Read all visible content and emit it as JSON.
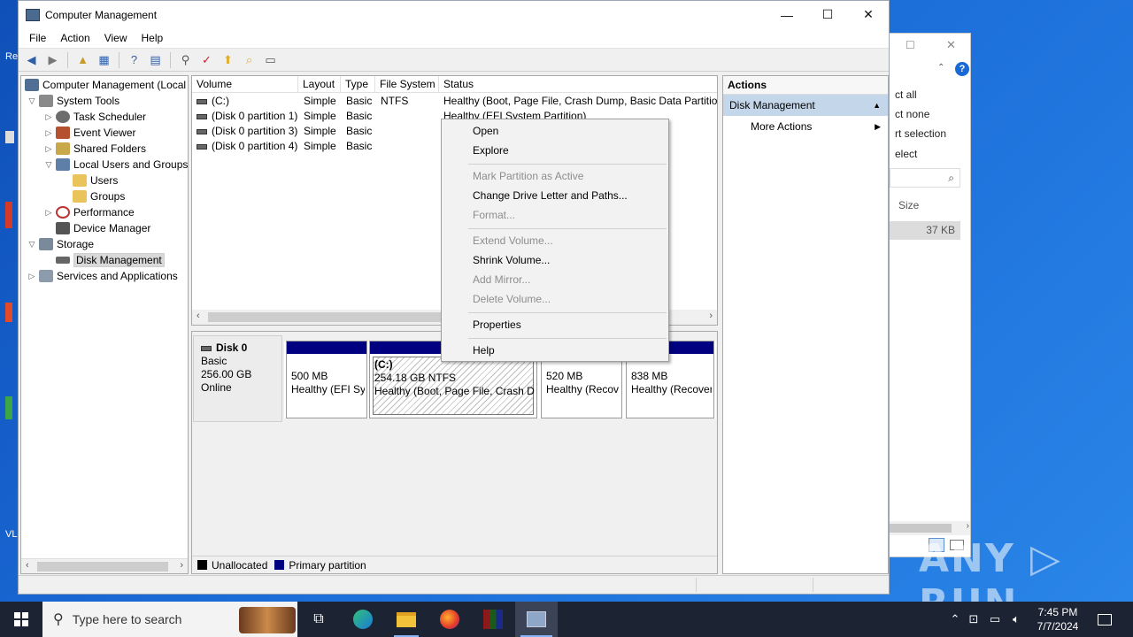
{
  "window": {
    "title": "Computer Management",
    "minimize": "—",
    "maximize": "☐",
    "close": "✕"
  },
  "menu": [
    "File",
    "Action",
    "View",
    "Help"
  ],
  "tree": {
    "root": "Computer Management (Local",
    "system_tools": "System Tools",
    "task_scheduler": "Task Scheduler",
    "event_viewer": "Event Viewer",
    "shared_folders": "Shared Folders",
    "local_users": "Local Users and Groups",
    "users": "Users",
    "groups": "Groups",
    "performance": "Performance",
    "device_manager": "Device Manager",
    "storage": "Storage",
    "disk_management": "Disk Management",
    "services": "Services and Applications"
  },
  "list": {
    "headers": [
      "Volume",
      "Layout",
      "Type",
      "File System",
      "Status"
    ],
    "rows": [
      [
        "(C:)",
        "Simple",
        "Basic",
        "NTFS",
        "Healthy (Boot, Page File, Crash Dump, Basic Data Partition)"
      ],
      [
        "(Disk 0 partition 1)",
        "Simple",
        "Basic",
        "",
        "Healthy (EFI System Partition)"
      ],
      [
        "(Disk 0 partition 3)",
        "Simple",
        "Basic",
        "",
        ""
      ],
      [
        "(Disk 0 partition 4)",
        "Simple",
        "Basic",
        "",
        ""
      ]
    ]
  },
  "disk": {
    "name": "Disk 0",
    "type": "Basic",
    "size": "256.00 GB",
    "status": "Online",
    "partitions": [
      {
        "size": "500 MB",
        "status": "Healthy (EFI Sy"
      },
      {
        "label": "(C:)",
        "size": "254.18 GB NTFS",
        "status": "Healthy (Boot, Page File, Crash Du"
      },
      {
        "size": "520 MB",
        "status": "Healthy (Recov"
      },
      {
        "size": "838 MB",
        "status": "Healthy (Recover"
      }
    ]
  },
  "legend": {
    "unallocated": "Unallocated",
    "primary": "Primary partition",
    "unallocated_color": "#000000",
    "primary_color": "#000080"
  },
  "actions": {
    "header": "Actions",
    "section": "Disk Management",
    "more": "More Actions"
  },
  "context_menu": {
    "open": "Open",
    "explore": "Explore",
    "mark_active": "Mark Partition as Active",
    "change_letter": "Change Drive Letter and Paths...",
    "format": "Format...",
    "extend": "Extend Volume...",
    "shrink": "Shrink Volume...",
    "add_mirror": "Add Mirror...",
    "delete": "Delete Volume...",
    "properties": "Properties",
    "help": "Help"
  },
  "bg_window": {
    "select_all": "ct all",
    "select_none": "ct none",
    "invert": "rt selection",
    "select": "elect",
    "size_header": "Size",
    "size_value": "37 KB"
  },
  "taskbar": {
    "search_placeholder": "Type here to search",
    "time": "7:45 PM",
    "date": "7/7/2024"
  },
  "watermark": "ANY ▷ RUN"
}
